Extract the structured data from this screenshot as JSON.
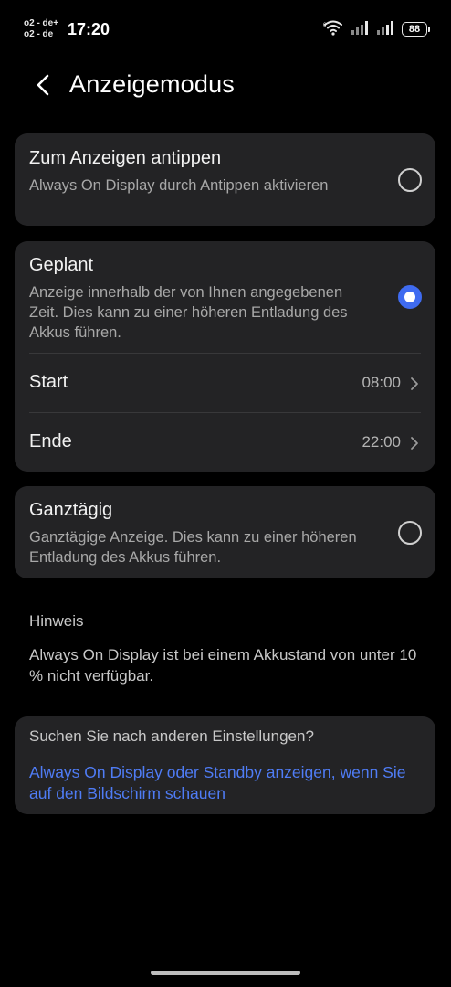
{
  "status_bar": {
    "carrier_1": "o2 - de+",
    "carrier_2": "o2 - de",
    "time": "17:20",
    "battery": "88",
    "icons": [
      "wifi-icon",
      "signal-icon",
      "signal-icon",
      "battery-icon"
    ]
  },
  "header": {
    "back_icon": "chevron-left-icon",
    "title": "Anzeigemodus"
  },
  "options": {
    "tap": {
      "title": "Zum Anzeigen antippen",
      "description": "Always On Display durch Antippen aktivieren",
      "selected": false
    },
    "scheduled": {
      "title": "Geplant",
      "description": "Anzeige innerhalb der von Ihnen angegebenen Zeit. Dies kann zu einer höheren Entladung des Akkus führen.",
      "selected": true,
      "start_label": "Start",
      "start_value": "08:00",
      "end_label": "Ende",
      "end_value": "22:00"
    },
    "always": {
      "title": "Ganztägig",
      "description": "Ganztägige Anzeige. Dies kann zu einer höheren Entladung des Akkus führen.",
      "selected": false
    }
  },
  "note": {
    "title": "Hinweis",
    "text": "Always On Display ist bei einem Akkustand von unter 10 % nicht verfügbar."
  },
  "suggestions": {
    "title": "Suchen Sie nach anderen Einstellungen?",
    "link": "Always On Display oder Standby anzeigen, wenn Sie auf den Bildschirm schauen"
  },
  "colors": {
    "background": "#000000",
    "card": "#232325",
    "accent": "#3f6bf0",
    "link": "#4f7cf5"
  }
}
